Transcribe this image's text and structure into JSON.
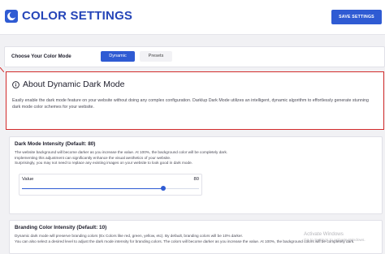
{
  "header": {
    "title": "COLOR SETTINGS",
    "save_label": "SAVE SETTINGS",
    "logo_icon": "darkmode-logo-icon",
    "accent": "#2f5bd3"
  },
  "mode": {
    "label": "Choose Your Color Mode",
    "tabs": [
      {
        "label": "Dynamic",
        "active": true
      },
      {
        "label": "Presets",
        "active": false
      }
    ]
  },
  "about": {
    "icon": "info-icon",
    "title": "About Dynamic Dark Mode",
    "text": "Easily enable the dark mode feature on your website without doing any complex configuration. Darklup Dark Mode utilizes an intelligent, dynamic algorithm to effortlessly generate stunning dark mode color schemes for your website.",
    "highlight_color": "#d22b2b"
  },
  "intensity": {
    "title": "Dark Mode Intensity (Default: 80)",
    "lines": [
      "The website background will become darker as you increase the value. At 100%, the background color will be completely dark.",
      "Implementing this adjustment can significantly enhance the visual aesthetics of your website.",
      "Surprisingly, you may not need to replace any existing images on your website to look good in dark mode."
    ],
    "slider": {
      "label": "Value",
      "value": "80",
      "fraction": 0.8
    }
  },
  "branding": {
    "title": "Branding Color Intensity (Default: 10)",
    "lines": [
      "Dynamic dark mode will preserve branding colors (Ex Colors like red, green, yellow, etc). By default, branding colors will be 10% darker.",
      "You can also select a desired level to adjust the dark mode intensity for branding colors. The colors will become darker as you increase the value. At 100%, the background colors will be completely dark."
    ]
  },
  "watermark": {
    "title": "Activate Windows",
    "subtitle": "Go to Settings to activate Windows."
  }
}
